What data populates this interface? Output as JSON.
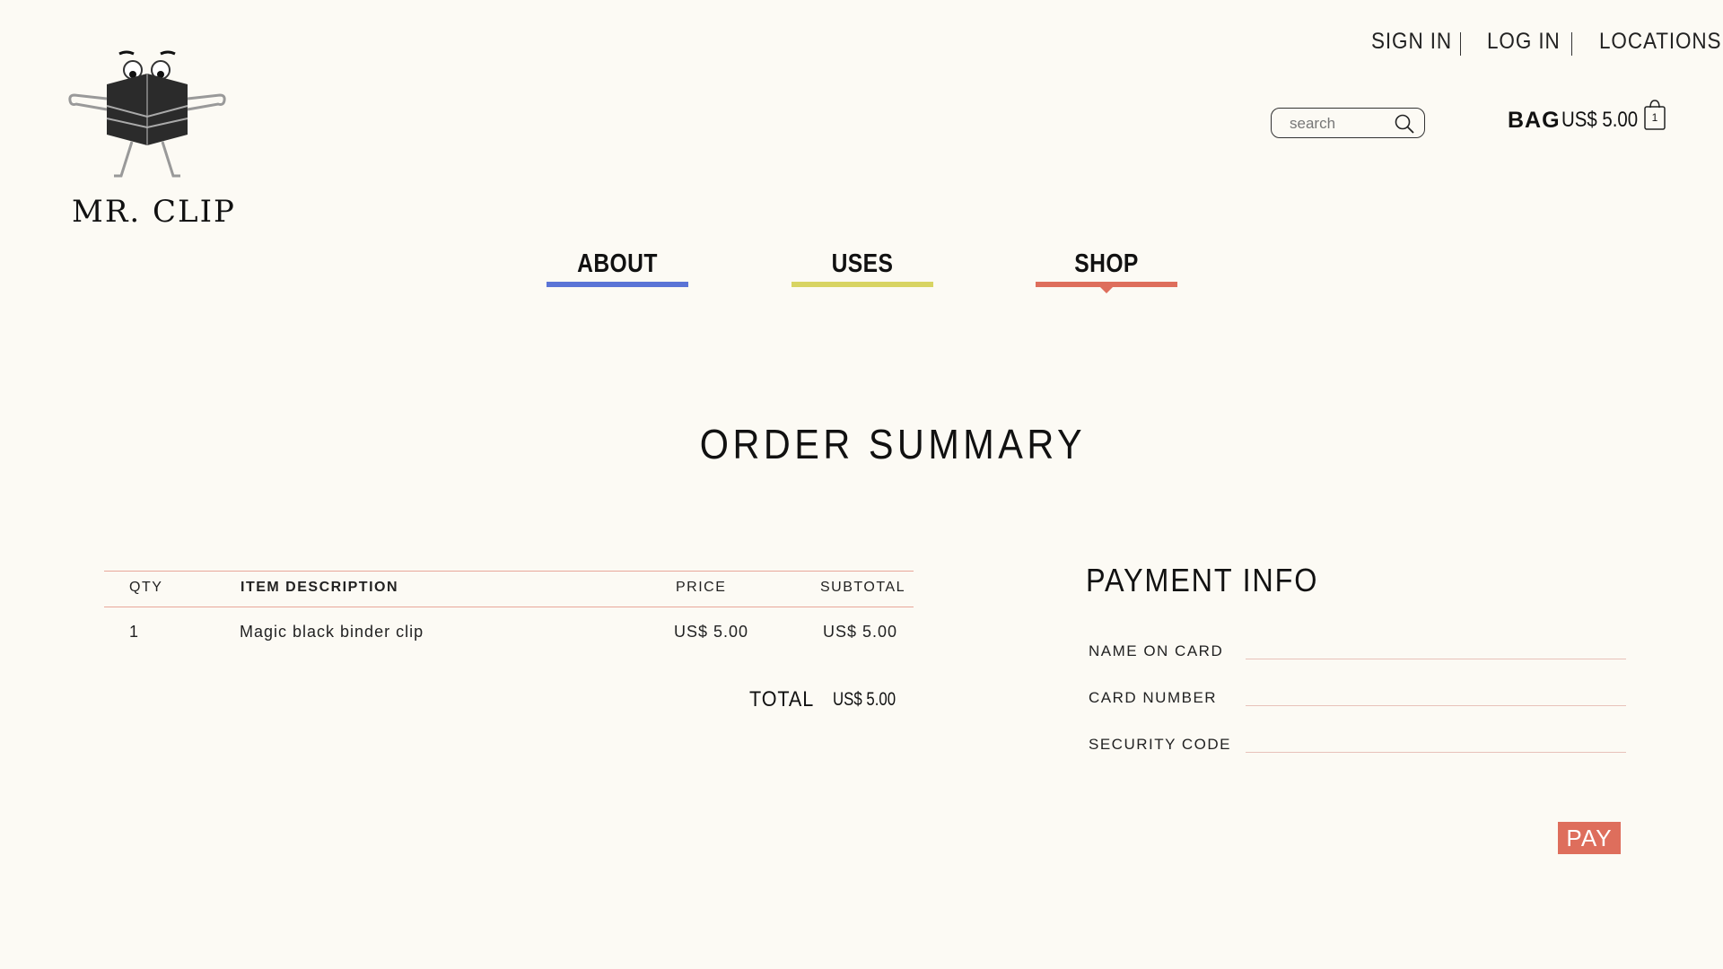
{
  "brand": {
    "name": "MR. CLIP"
  },
  "top_links": {
    "sign_in": "SIGN IN",
    "log_in": "LOG IN",
    "locations": "LOCATIONS"
  },
  "search": {
    "placeholder": "search",
    "icon": "search-icon"
  },
  "bag": {
    "label": "BAG",
    "amount": "US$ 5.00",
    "count": "1",
    "icon": "shopping-bag-icon"
  },
  "nav": {
    "tabs": [
      {
        "label": "ABOUT",
        "color": "#5b74d6"
      },
      {
        "label": "USES",
        "color": "#d8d463"
      },
      {
        "label": "SHOP",
        "color": "#de6e5c",
        "active": true
      }
    ]
  },
  "order": {
    "title": "ORDER SUMMARY",
    "columns": {
      "qty": "QTY",
      "description": "ITEM DESCRIPTION",
      "price": "PRICE",
      "subtotal": "SUBTOTAL"
    },
    "rows": [
      {
        "qty": "1",
        "description": "Magic black binder clip",
        "price": "US$ 5.00",
        "subtotal": "US$ 5.00"
      }
    ],
    "total_label": "TOTAL",
    "total_value": "US$ 5.00"
  },
  "payment": {
    "title": "PAYMENT INFO",
    "name_label": "NAME ON CARD",
    "number_label": "CARD NUMBER",
    "code_label": "SECURITY CODE",
    "pay_label": "PAY"
  },
  "colors": {
    "background": "#fcfaf4",
    "accent": "#de6e5c",
    "about": "#5b74d6",
    "uses": "#d8d463",
    "shop": "#de6e5c"
  }
}
